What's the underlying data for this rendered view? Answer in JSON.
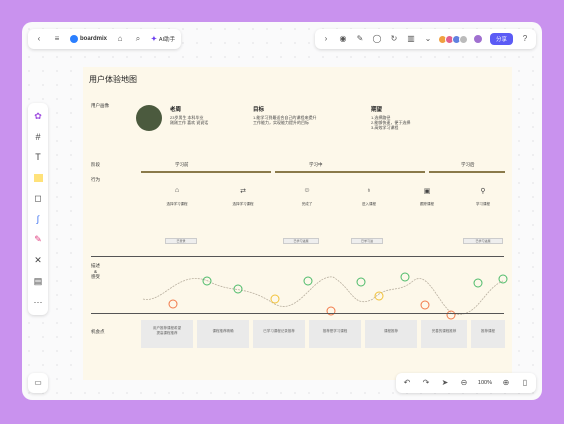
{
  "toolbar": {
    "app_name": "boardmix",
    "ai_label": "AI助手",
    "share_label": "分享"
  },
  "board": {
    "title": "用户体验地图",
    "row_labels": {
      "persona": "用户画像",
      "stage": "阶段",
      "action": "行为",
      "emotion": "描述\n&\n感受",
      "opportunity": "机会点"
    },
    "persona": {
      "name": "老周",
      "desc": "23岁男生 本科毕业\n刚刚工作 喜欢 说说话"
    },
    "goal": {
      "heading": "目标",
      "text": "1.能学习到最适合自己的课程来提升\n工作能力，实现能力提升的目标"
    },
    "expectation": {
      "heading": "期望",
      "text": "1.选择路径\n2.能够快速，便于选择\n3.高效学习课程"
    },
    "stages": [
      "学习前",
      "学习中",
      "学习后"
    ],
    "actions": [
      "选择学习课程",
      "选择学习课程",
      "完成了",
      "进入课程",
      "跟踪课程",
      "学习课程"
    ],
    "action_tags": [
      "已登录",
      "已学习进展",
      "已学习进",
      "已学习进展"
    ],
    "opportunities": [
      "用户推荐课程希望\n提高课程推荐",
      "课程推荐精确",
      "已学习课程记录推荐",
      "推荐是学习课程",
      "课程推荐",
      "完善的课程推荐",
      "推荐课程"
    ]
  },
  "zoom": {
    "value": "100%"
  },
  "colors": {
    "accent": "#5b5bf5",
    "stage_line": "#8a7a4a",
    "happy": "#4dbb6a",
    "neutral": "#f2c23a",
    "sad": "#f27a4a"
  }
}
